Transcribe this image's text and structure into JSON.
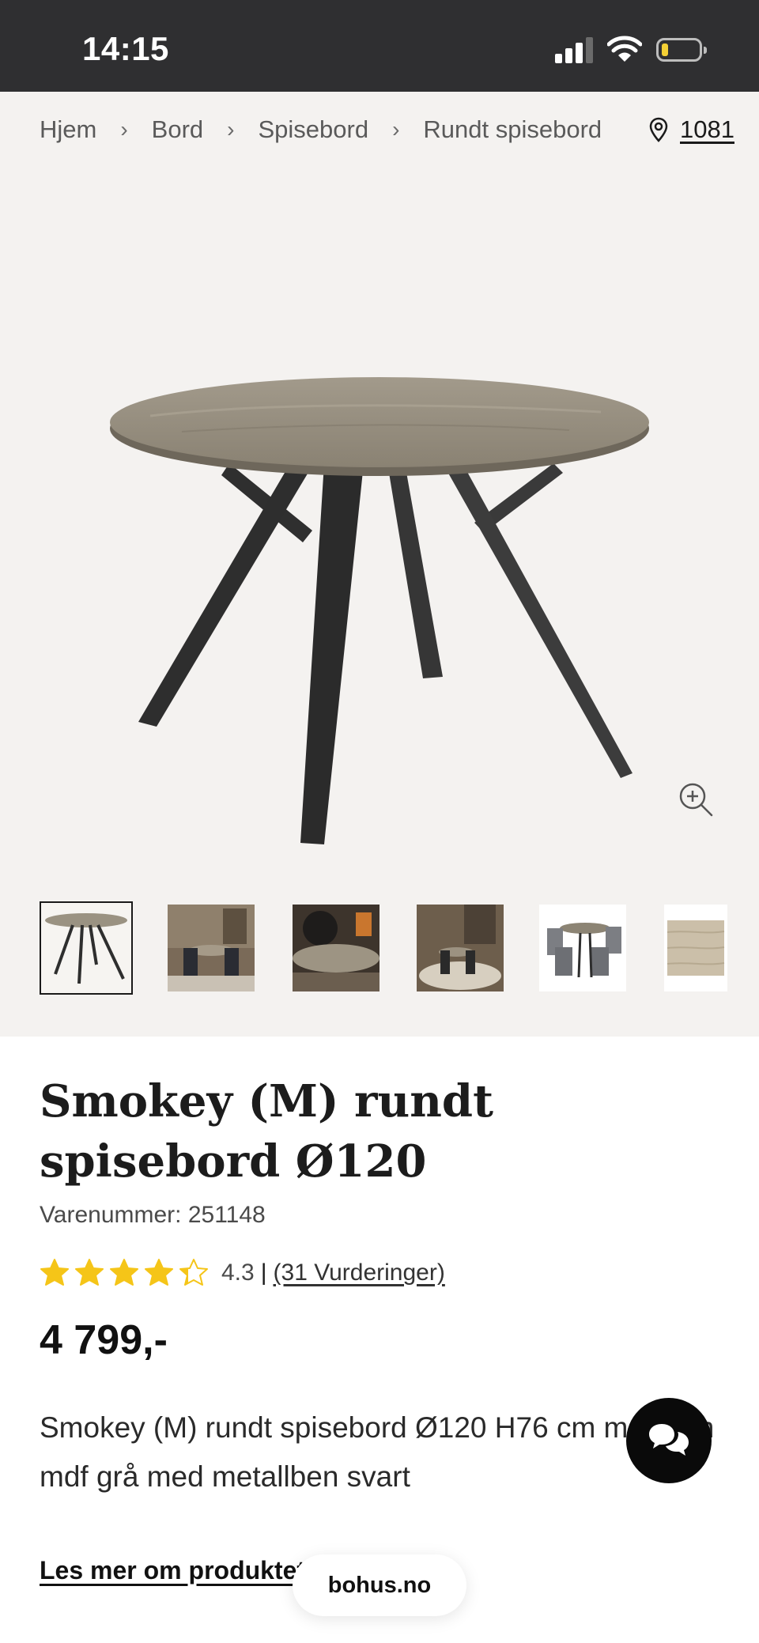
{
  "status_bar": {
    "time": "14:15",
    "signal_bars": 3,
    "signal_max": 4,
    "battery_level": 0.2,
    "battery_color": "#f4d035"
  },
  "breadcrumb": [
    {
      "label": "Hjem"
    },
    {
      "label": "Bord"
    },
    {
      "label": "Spisebord"
    },
    {
      "label": "Rundt spisebord"
    }
  ],
  "breadcrumb_separator": "›",
  "store": {
    "icon": "location-pin-icon",
    "code": "1081"
  },
  "gallery": {
    "zoom_icon": "zoom-in-icon",
    "selected_index": 0,
    "thumbnails": [
      {
        "kind": "table-product"
      },
      {
        "kind": "room-scene"
      },
      {
        "kind": "room-scene-closeup"
      },
      {
        "kind": "room-scene-rug"
      },
      {
        "kind": "table-with-chairs"
      },
      {
        "kind": "wood-texture"
      }
    ]
  },
  "product": {
    "title": "Smokey (M) rundt spisebord Ø120",
    "sku_label": "Varenummer:",
    "sku": "251148",
    "rating": 4.3,
    "rating_display": "4.3",
    "rating_separator": "|",
    "reviews_label": "(31 Vurderinger)",
    "price": "4 799,-",
    "description": "Smokey (M) rundt spisebord Ø120 H76 cm melamin mdf grå med metallben svart",
    "read_more": "Les mer om produktet"
  },
  "chat": {
    "icon": "chat-bubbles-icon"
  },
  "browser": {
    "url": "bohus.no"
  },
  "colors": {
    "status_bar": "#2f2f31",
    "gallery_bg": "#f4f2f0",
    "star": "#f5c518",
    "text": "#1a1a1a"
  }
}
